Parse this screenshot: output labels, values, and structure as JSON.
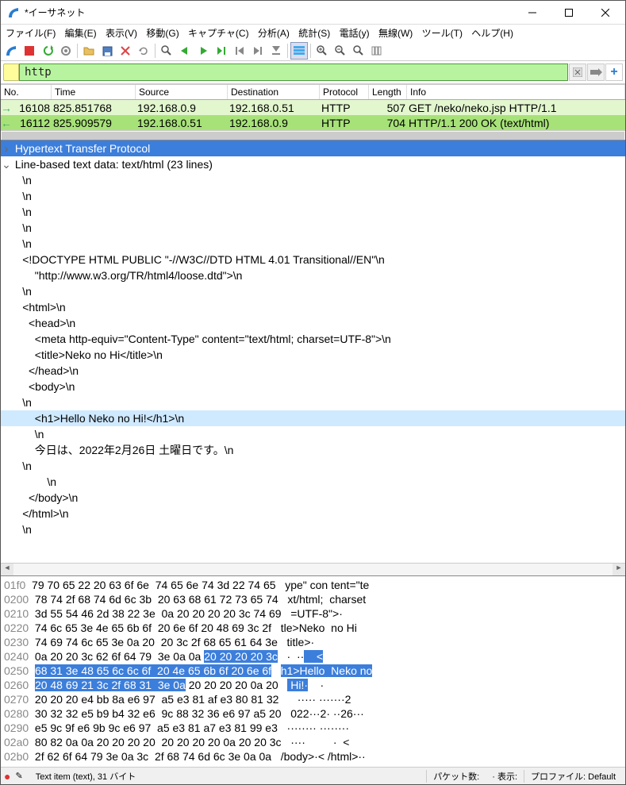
{
  "title": "*イーサネット",
  "menu": [
    "ファイル(F)",
    "編集(E)",
    "表示(V)",
    "移動(G)",
    "キャプチャ(C)",
    "分析(A)",
    "統計(S)",
    "電話(y)",
    "無線(W)",
    "ツール(T)",
    "ヘルプ(H)"
  ],
  "filter": "http",
  "columns": {
    "no": "No.",
    "time": "Time",
    "src": "Source",
    "dst": "Destination",
    "proto": "Protocol",
    "len": "Length",
    "info": "Info"
  },
  "packets": [
    {
      "no": "16108",
      "time": "825.851768",
      "src": "192.168.0.9",
      "dst": "192.168.0.51",
      "proto": "HTTP",
      "len": "507",
      "info": "GET /neko/neko.jsp HTTP/1.1"
    },
    {
      "no": "16112",
      "time": "825.909579",
      "src": "192.168.0.51",
      "dst": "192.168.0.9",
      "proto": "HTTP",
      "len": "704",
      "info": "HTTP/1.1 200 OK  (text/html)"
    }
  ],
  "details": {
    "header": "Hypertext Transfer Protocol",
    "sub": "Line-based text data: text/html (23 lines)",
    "lines": [
      "\\n",
      "\\n",
      "\\n",
      "\\n",
      "\\n",
      "<!DOCTYPE HTML PUBLIC \"-//W3C//DTD HTML 4.01 Transitional//EN\"\\n",
      "    \"http://www.w3.org/TR/html4/loose.dtd\">\\n",
      "\\n",
      "<html>\\n",
      "  <head>\\n",
      "    <meta http-equiv=\"Content-Type\" content=\"text/html; charset=UTF-8\">\\n",
      "    <title>Neko no Hi</title>\\n",
      "  </head>\\n",
      "  <body>\\n",
      "\\n",
      "    <h1>Hello Neko no Hi!</h1>\\n",
      "    \\n",
      "    今日は、2022年2月26日 土曜日です。\\n",
      "\\n",
      "        \\n",
      "  </body>\\n",
      "</html>\\n",
      "\\n"
    ],
    "selected_index": 15
  },
  "hex": [
    {
      "off": "01f0",
      "b": "79 70 65 22 20 63 6f 6e  74 65 6e 74 3d 22 74 65",
      "a": "ype\" con tent=\"te"
    },
    {
      "off": "0200",
      "b": "78 74 2f 68 74 6d 6c 3b  20 63 68 61 72 73 65 74",
      "a": "xt/html;  charset"
    },
    {
      "off": "0210",
      "b": "3d 55 54 46 2d 38 22 3e  0a 20 20 20 20 3c 74 69",
      "a": "=UTF-8\">·    <ti"
    },
    {
      "off": "0220",
      "b": "74 6c 65 3e 4e 65 6b 6f  20 6e 6f 20 48 69 3c 2f",
      "a": "tle>Neko  no Hi</"
    },
    {
      "off": "0230",
      "b": "74 69 74 6c 65 3e 0a 20  20 3c 2f 68 65 61 64 3e",
      "a": "title>·   </head>"
    },
    {
      "off": "0240",
      "b": "0a 20 20 3c 62 6f 64 79  3e 0a 0a ",
      "bs": "20 20 20 20 3c",
      "a": "·  <body >··",
      "as": "    <"
    },
    {
      "off": "0250",
      "bsfull": "68 31 3e 48 65 6c 6c 6f  20 4e 65 6b 6f 20 6e 6f",
      "asfull": "h1>Hello  Neko no"
    },
    {
      "off": "0260",
      "bs": "20 48 69 21 3c 2f 68 31  3e 0a",
      "b": " 20 20 20 20 0a 20",
      "as": " Hi!</h1 >·",
      "a": "    · "
    },
    {
      "off": "0270",
      "b": "20 20 20 e4 bb 8a e6 97  a5 e3 81 af e3 80 81 32",
      "a": "   ····· ·······2"
    },
    {
      "off": "0280",
      "b": "30 32 32 e5 b9 b4 32 e6  9c 88 32 36 e6 97 a5 20",
      "a": "022···2· ··26··· "
    },
    {
      "off": "0290",
      "b": "e5 9c 9f e6 9b 9c e6 97  a5 e3 81 a7 e3 81 99 e3",
      "a": "········ ········"
    },
    {
      "off": "02a0",
      "b": "80 82 0a 0a 20 20 20 20  20 20 20 20 0a 20 20 3c",
      "a": "····         ·  <"
    },
    {
      "off": "02b0",
      "b": "2f 62 6f 64 79 3e 0a 3c  2f 68 74 6d 6c 3e 0a 0a",
      "a": "/body>·< /html>··"
    }
  ],
  "status": {
    "left": "Text item (text), 31 バイト",
    "pkt": "パケット数:",
    "disp": "· 表示:",
    "profile": "プロファイル: Default"
  }
}
